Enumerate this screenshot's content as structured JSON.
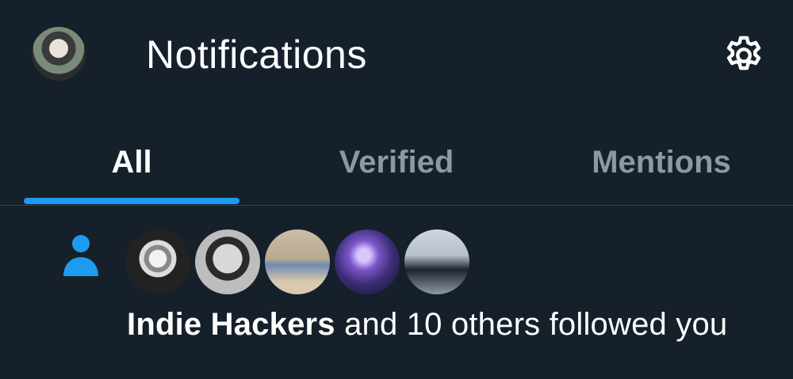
{
  "header": {
    "title": "Notifications",
    "settings_icon": "gear-icon",
    "avatar": "profile-avatar"
  },
  "tabs": [
    {
      "label": "All",
      "active": true
    },
    {
      "label": "Verified",
      "active": false
    },
    {
      "label": "Mentions",
      "active": false
    }
  ],
  "colors": {
    "background": "#15202b",
    "accent": "#1d9bf0",
    "muted": "#8b98a5",
    "divider": "#38444d"
  },
  "notification": {
    "type_icon": "person-icon",
    "avatar_count": 5,
    "actor": "Indie Hackers",
    "rest": " and 10 others followed you"
  }
}
